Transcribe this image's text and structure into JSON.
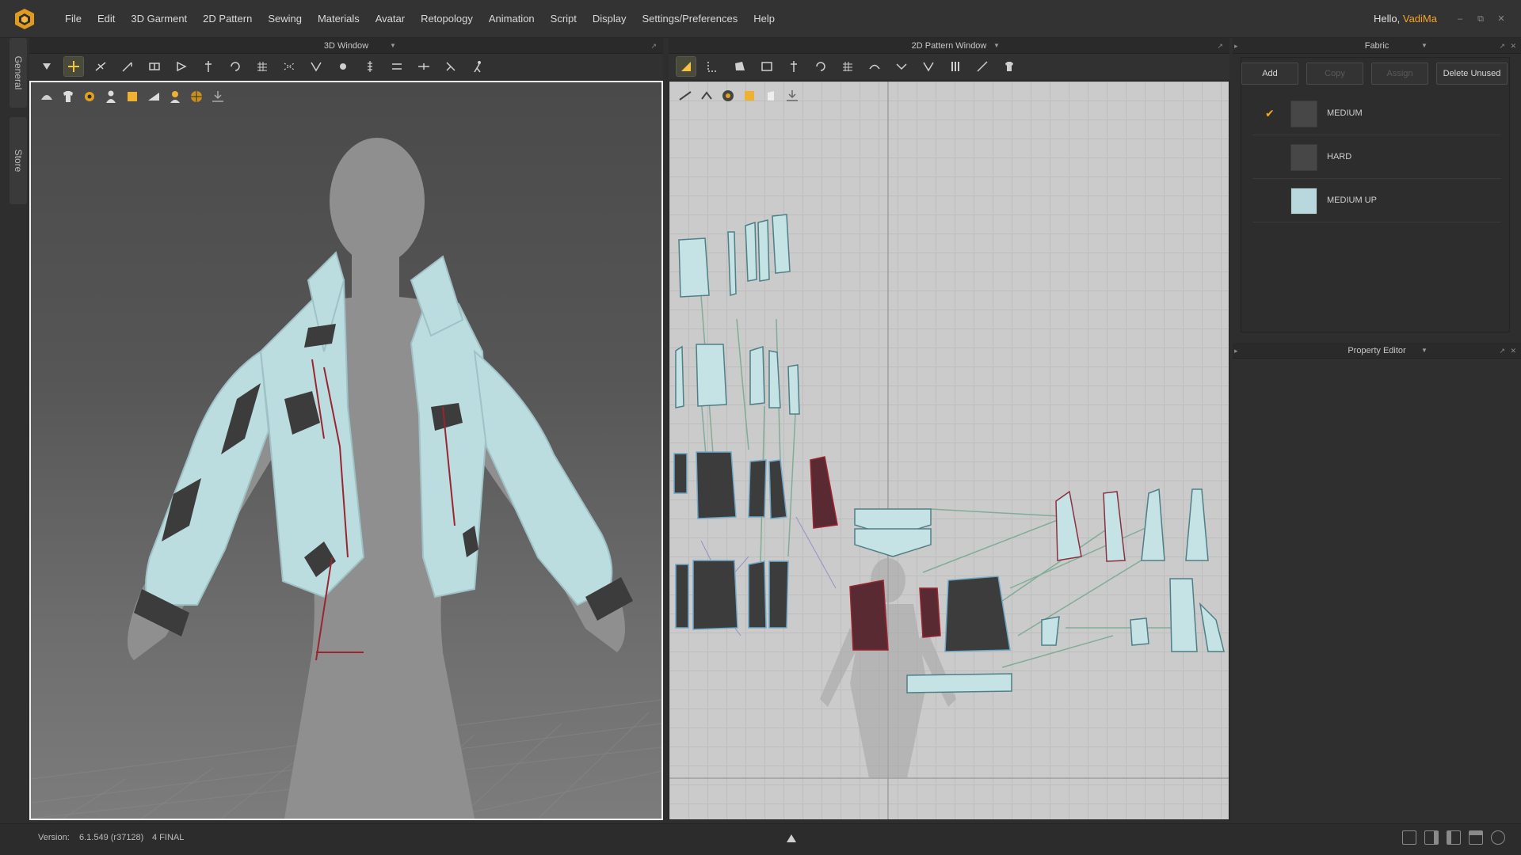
{
  "menu": {
    "items": [
      "File",
      "Edit",
      "3D Garment",
      "2D Pattern",
      "Sewing",
      "Materials",
      "Avatar",
      "Retopology",
      "Animation",
      "Script",
      "Display",
      "Settings/Preferences",
      "Help"
    ],
    "greeting_prefix": "Hello,",
    "username": "VadiMa"
  },
  "side_tabs": [
    "General",
    "Store"
  ],
  "panels": {
    "window3d": {
      "title": "3D Window"
    },
    "window2d": {
      "title": "2D Pattern Window"
    },
    "fabric": {
      "title": "Fabric",
      "buttons": {
        "add": "Add",
        "copy": "Copy",
        "assign": "Assign",
        "delete_unused": "Delete Unused"
      },
      "items": [
        {
          "name": "MEDIUM",
          "selected": true,
          "color": "#474747"
        },
        {
          "name": "HARD",
          "selected": false,
          "color": "#474747"
        },
        {
          "name": "MEDIUM UP",
          "selected": false,
          "color": "#b7d8dc"
        }
      ]
    },
    "property_editor": {
      "title": "Property Editor"
    }
  },
  "colors": {
    "accent": "#f5a623",
    "garment": "#bcdde0",
    "avatar": "#8f8f8f",
    "pattern_dark": "#3c3c3c",
    "pattern_light": "#c5e2e4",
    "seam_red": "#9a2530"
  },
  "status": {
    "version_label": "Version:",
    "version_value": "6.1.549 (r37128)",
    "build": "4 FINAL"
  }
}
